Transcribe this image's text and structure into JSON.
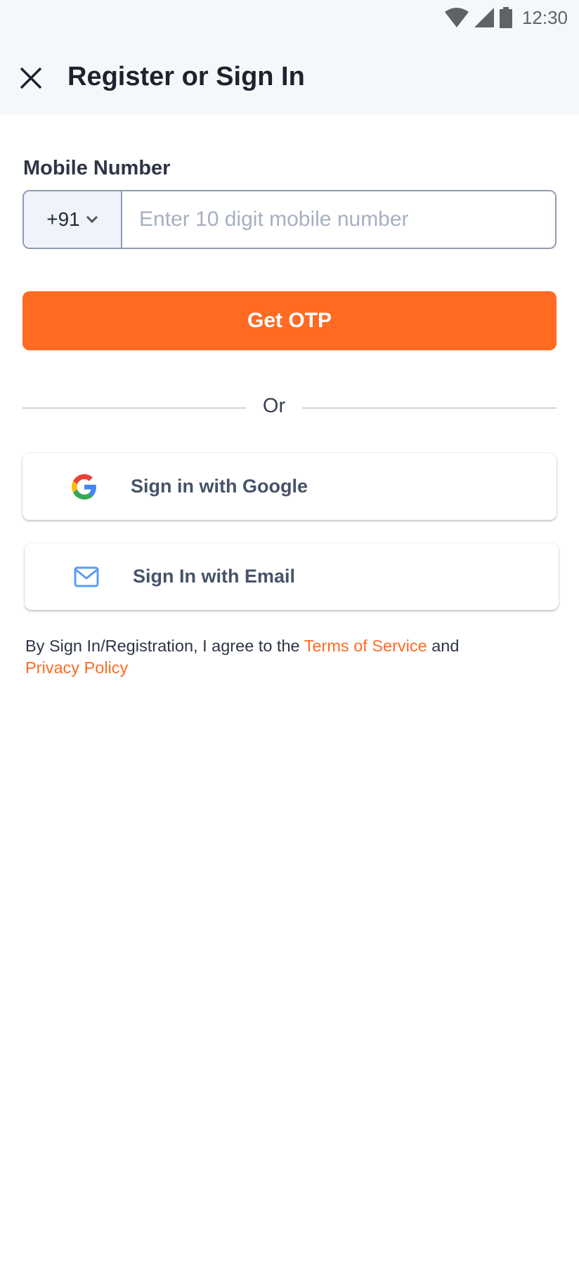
{
  "status_bar": {
    "time": "12:30",
    "icons": [
      "wifi-icon",
      "signal-icon",
      "battery-icon"
    ]
  },
  "header": {
    "title": "Register or Sign In",
    "close_icon": "close-icon"
  },
  "form": {
    "label": "Mobile Number",
    "country_code": "+91",
    "phone_value": "",
    "phone_placeholder": "Enter 10 digit mobile number",
    "submit_label": "Get OTP"
  },
  "divider_text": "Or",
  "social": {
    "google_label": "Sign in with Google",
    "email_label": "Sign In with Email"
  },
  "terms": {
    "prefix": "By Sign In/Registration, I agree to the ",
    "terms_link": "Terms of Service",
    "middle": " and ",
    "privacy_link": "Privacy Policy"
  },
  "colors": {
    "accent": "#ff6b22",
    "header_bg": "#f5f8fb"
  }
}
